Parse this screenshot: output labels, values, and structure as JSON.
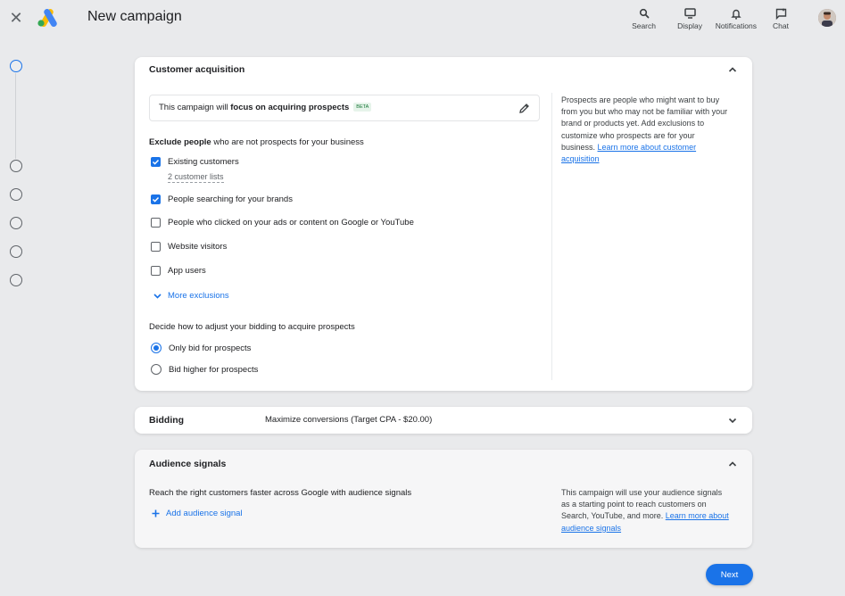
{
  "header": {
    "title": "New campaign",
    "actions": [
      {
        "label": "Search",
        "icon": "search-icon"
      },
      {
        "label": "Display",
        "icon": "display-icon"
      },
      {
        "label": "Notifications",
        "icon": "bell-icon"
      },
      {
        "label": "Chat",
        "icon": "chat-icon"
      }
    ]
  },
  "customer_acquisition": {
    "title": "Customer acquisition",
    "focus_prefix": "This campaign will ",
    "focus_bold": "focus on acquiring prospects",
    "beta_label": "BETA",
    "exclude_heading_bold": "Exclude people",
    "exclude_heading_rest": " who are not prospects for your business",
    "exclusions": [
      {
        "label": "Existing customers",
        "checked": true
      },
      {
        "label": "People searching for your brands",
        "checked": true
      },
      {
        "label": "People who clicked on your ads or content on Google or YouTube",
        "checked": false
      },
      {
        "label": "Website visitors",
        "checked": false
      },
      {
        "label": "App users",
        "checked": false
      }
    ],
    "existing_customers_sublink": "2 customer lists",
    "more_exclusions": "More exclusions",
    "bidding_heading": "Decide how to adjust your bidding to acquire prospects",
    "bidding_options": [
      {
        "label": "Only bid for prospects",
        "selected": true
      },
      {
        "label": "Bid higher for prospects",
        "selected": false
      }
    ],
    "help_text": "Prospects are people who might want to buy from you but who may not be familiar with your brand or products yet. Add exclusions to customize who prospects are for your business. ",
    "help_link": "Learn more about customer acquisition"
  },
  "bidding": {
    "title": "Bidding",
    "value": "Maximize conversions (Target CPA - $20.00)"
  },
  "audience_signals": {
    "title": "Audience signals",
    "description": "Reach the right customers faster across Google with audience signals",
    "add_label": "Add audience signal",
    "help_text": "This campaign will use your audience signals as a starting point to reach customers on Search, YouTube, and more. ",
    "help_link": "Learn more about audience signals"
  },
  "footer": {
    "next_label": "Next"
  },
  "colors": {
    "accent": "#1a73e8",
    "background": "#e9eaec"
  }
}
